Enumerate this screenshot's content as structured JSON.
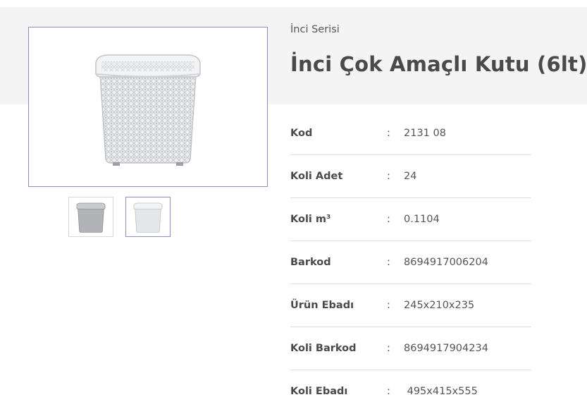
{
  "product": {
    "series": "İnci Serisi",
    "title": "İnci Çok Amaçlı Kutu (6lt)"
  },
  "gallery": {
    "main_image": "basket-image",
    "thumbnails": [
      {
        "image": "basket-thumbnail",
        "selected": false
      },
      {
        "image": "basket-thumbnail",
        "selected": true
      }
    ],
    "selected_border_color": "#8f8fbf"
  },
  "specs": [
    {
      "label": "Kod",
      "colon": ":",
      "value": "2131 08"
    },
    {
      "label": "Koli Adet",
      "colon": ":",
      "value": "24"
    },
    {
      "label": "Koli m³",
      "colon": ":",
      "value": "0.1104"
    },
    {
      "label": "Barkod",
      "colon": ":",
      "value": "8694917006204"
    },
    {
      "label": "Ürün Ebadı",
      "colon": ":",
      "value": "245x210x235"
    },
    {
      "label": "Koli Barkod",
      "colon": ":",
      "value": "8694917904234"
    },
    {
      "label": "Koli Ebadı",
      "colon": ":",
      "value": " 495x415x555"
    }
  ]
}
